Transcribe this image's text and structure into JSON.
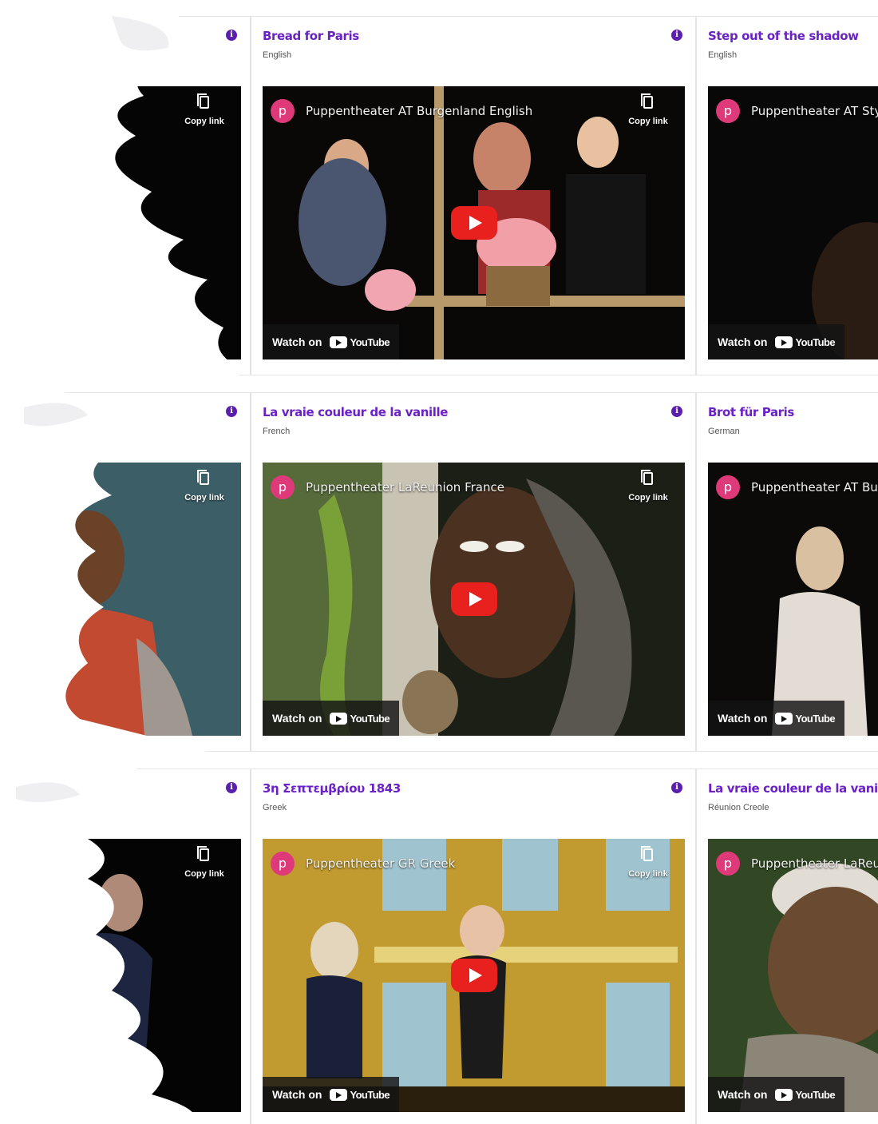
{
  "common": {
    "info_icon_glyph": "i",
    "copy_link_label": "Copy link",
    "watch_on_label": "Watch on",
    "youtube_wordmark": "YouTube",
    "avatar_letter": "p",
    "avatar_color": "#de3a7a",
    "title_color": "#6a22c4",
    "play_button_color": "#e8201e"
  },
  "rows": [
    {
      "cards": [
        {
          "title": "",
          "language": "",
          "channel": ""
        },
        {
          "title": "Bread for Paris",
          "language": "English",
          "channel": "Puppentheater AT Burgenland English"
        },
        {
          "title": "Step out of the shadow",
          "language": "English",
          "channel": "Puppentheater AT Styri"
        }
      ]
    },
    {
      "cards": [
        {
          "title": "",
          "language": "",
          "channel": ""
        },
        {
          "title": "La vraie couleur de la vanille",
          "language": "French",
          "channel": "Puppentheater LaReunion France"
        },
        {
          "title": "Brot für Paris",
          "language": "German",
          "channel": "Puppentheater AT Burg"
        }
      ]
    },
    {
      "cards": [
        {
          "title": "",
          "language": "",
          "channel": ""
        },
        {
          "title": "3η Σεπτεμβρίου 1843",
          "language": "Greek",
          "channel": "Puppentheater GR Greek"
        },
        {
          "title": "La vraie couleur de la vanille (Cr",
          "language": "Réunion Creole",
          "channel": "Puppentheater LaReun"
        }
      ]
    }
  ]
}
